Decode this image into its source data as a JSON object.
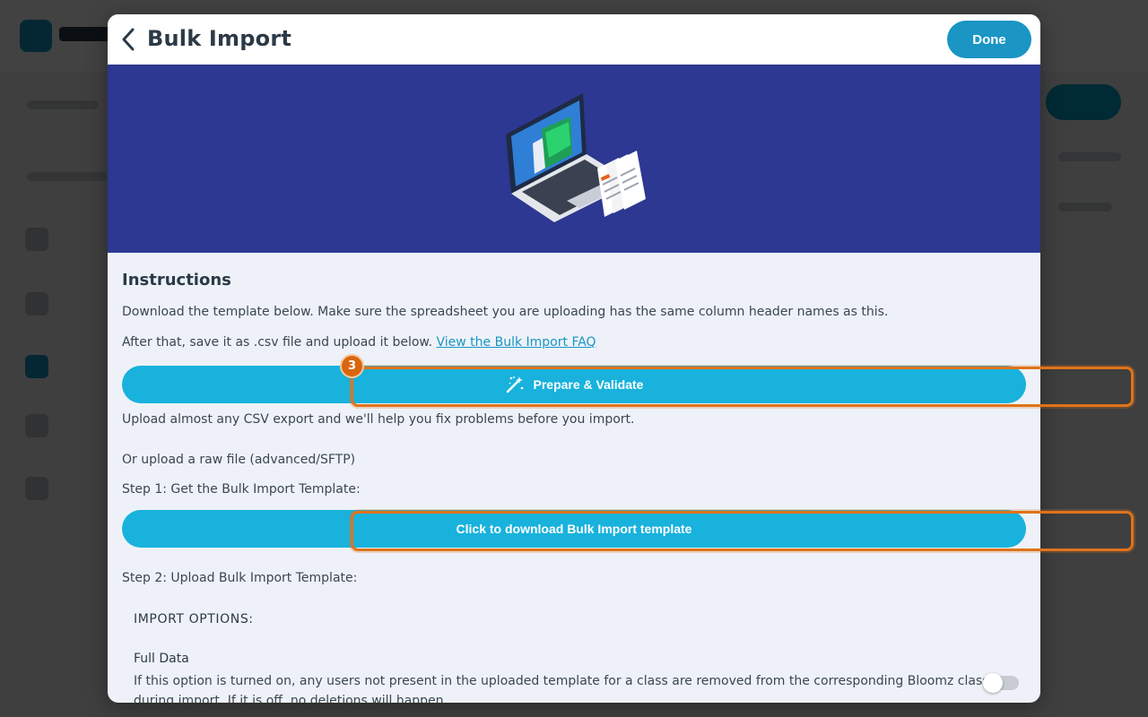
{
  "modal": {
    "title": "Bulk Import",
    "done_label": "Done"
  },
  "instructions": {
    "heading": "Instructions",
    "line1": "Download the template below. Make sure the spreadsheet you are uploading has the same column header names as this.",
    "line2_prefix": "After that, save it as .csv file and upload it below.",
    "faq_link": "View the Bulk Import FAQ",
    "prepare_label": "Prepare & Validate",
    "prepare_hint": "Upload almost any CSV export and we'll help you fix problems before you import.",
    "raw_heading": "Or upload a raw file (advanced/SFTP)",
    "step1": "Step 1: Get the Bulk Import Template:",
    "download_label": "Click to download Bulk Import template",
    "step2": "Step 2: Upload Bulk Import Template:",
    "import_options": "IMPORT OPTIONS:",
    "full_data_label": "Full Data",
    "full_data_desc": "If this option is turned on, any users not present in the uploaded template for a class are removed from the corresponding Bloomz class",
    "full_data_desc2": "during import. If it is off, no deletions will happen.",
    "full_data_enabled": false
  },
  "walkthrough": {
    "step_number": "3",
    "accent": "#e0731a"
  },
  "icons": {
    "back": "chevron-left-icon",
    "wand": "magic-wand-icon",
    "banner": "laptop-upload-illustration"
  }
}
